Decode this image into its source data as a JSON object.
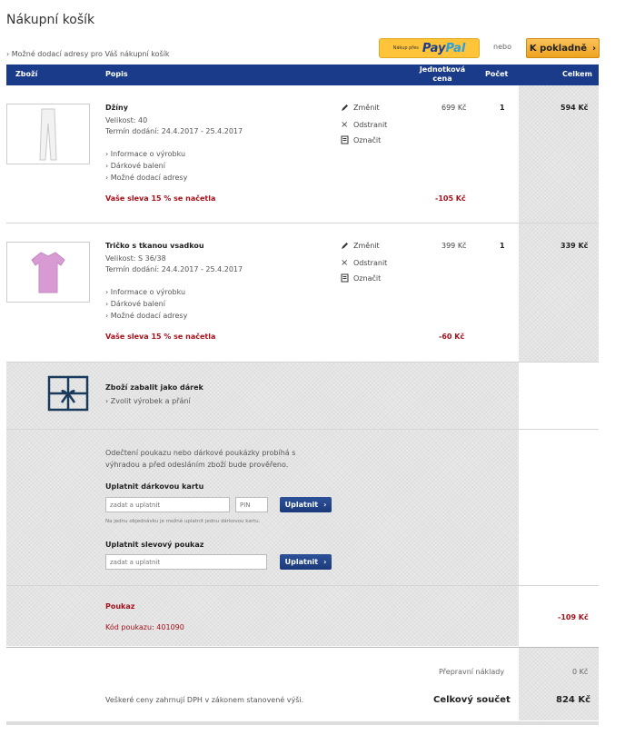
{
  "page": {
    "title": "Nákupní košík"
  },
  "top": {
    "delivery_link": "Možné dodací adresy pro Váš nákupní košík",
    "paypal_prefix": "Nákup přes",
    "paypal_logo_a": "Pay",
    "paypal_logo_b": "Pal",
    "or_label": "nebo",
    "checkout_label": "K pokladně",
    "checkout_arrow": "›"
  },
  "columns": {
    "goods": "Zboží",
    "description": "Popis",
    "unit_price_line1": "Jednotková",
    "unit_price_line2": "cena",
    "count": "Počet",
    "total": "Celkem"
  },
  "items": [
    {
      "name": "Džíny",
      "size": "Velikost: 40",
      "delivery": "Termín dodání: 24.4.2017 - 25.4.2017",
      "links": [
        "Informace o výrobku",
        "Dárkové balení",
        "Možné dodací adresy"
      ],
      "discount_text": "Vaše sleva 15 % se načetla",
      "discount_value": "-105 Kč",
      "actions": [
        "Změnit",
        "Odstranit",
        "Označit"
      ],
      "unit_price": "699 Kč",
      "quantity": "1",
      "total": "594 Kč"
    },
    {
      "name": "Tričko s tkanou vsadkou",
      "size": "Velikost: S 36/38",
      "delivery": "Termín dodání: 24.4.2017 - 25.4.2017",
      "links": [
        "Informace o výrobku",
        "Dárkové balení",
        "Možné dodací adresy"
      ],
      "discount_text": "Vaše sleva 15 % se načetla",
      "discount_value": "-60 Kč",
      "actions": [
        "Změnit",
        "Odstranit",
        "Označit"
      ],
      "unit_price": "399 Kč",
      "quantity": "1",
      "total": "339 Kč"
    }
  ],
  "gift": {
    "title": "Zboží zabalit jako dárek",
    "link": "Zvolit výrobek a přání"
  },
  "voucher": {
    "info_line1": "Odečtení poukazu nebo dárkové poukázky probíhá s",
    "info_line2": "výhradou a před odesláním zboží bude prověřeno.",
    "giftcard_title": "Uplatnit dárkovou kartu",
    "giftcard_placeholder": "zadat a uplatnit",
    "pin_placeholder": "PIN",
    "apply_label": "Uplatnit",
    "apply_arrow": "›",
    "giftcard_note": "Na jednu objednávku je možné uplatnit jednu dárkovou kartu.",
    "coupon_title": "Uplatnit slevový poukaz",
    "coupon_placeholder": "zadat a uplatnit"
  },
  "applied_voucher": {
    "title": "Poukaz",
    "code_text": "Kód poukazu: 401090",
    "value": "-109 Kč"
  },
  "summary": {
    "shipping_label": "Přepravní náklady",
    "shipping_value": "0 Kč",
    "vat_note": "Veškeré ceny zahrnují DPH v zákonem stanovené výši.",
    "grand_total_label": "Celkový součet",
    "grand_total_value": "824 Kč"
  },
  "colors": {
    "header_blue": "#1a3a8a",
    "discount_red": "#a6111b",
    "checkout_orange": "#eea21f",
    "paypal_yellow": "#ffc439"
  }
}
